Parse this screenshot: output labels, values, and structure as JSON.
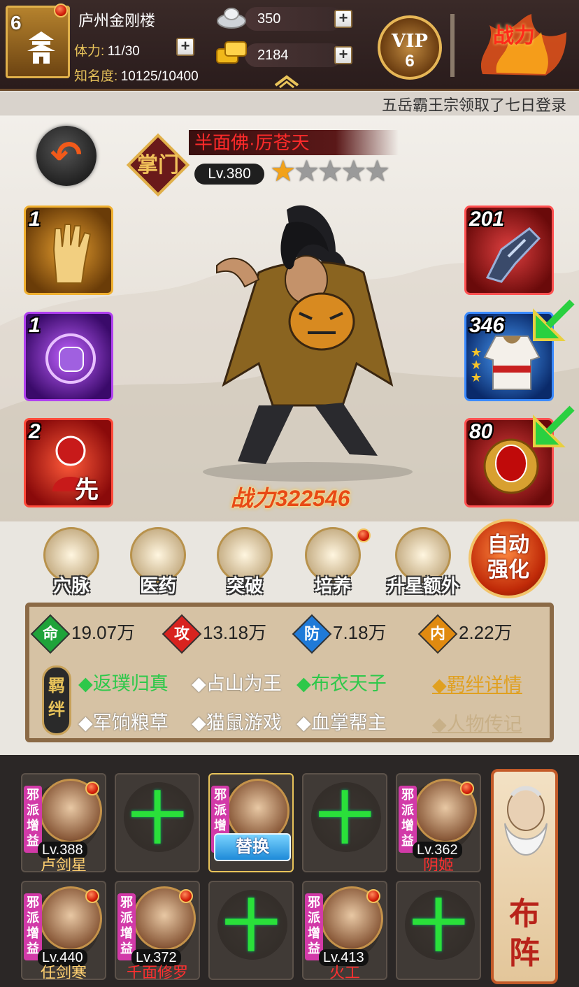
{
  "player": {
    "level": "6",
    "name": "庐州金刚楼"
  },
  "stats": {
    "stamina_label": "体力:",
    "stamina_value": "11/30",
    "fame_label": "知名度:",
    "fame_value": "10125/10400"
  },
  "resources": {
    "silver": "350",
    "gold": "2184"
  },
  "vip": {
    "label": "VIP",
    "level": "6"
  },
  "combat_top": {
    "label": "战力"
  },
  "marquee": "五岳霸王宗领取了七日登录",
  "hero": {
    "name": "半面佛·厉苍天",
    "level": "Lv.380",
    "stars_filled": 1,
    "stars_total": 5,
    "sect_badge": "掌门",
    "power_label": "战力",
    "power_value": "322546"
  },
  "skills": [
    {
      "level": "1",
      "icon": "palm-skill-icon"
    },
    {
      "level": "1",
      "icon": "fist-skill-icon"
    },
    {
      "level": "2",
      "icon": "first-strike-icon",
      "text": "先"
    }
  ],
  "equipment": [
    {
      "level": "201",
      "icon": "gauntlet-icon"
    },
    {
      "level": "346",
      "icon": "robe-icon",
      "upgrade": true
    },
    {
      "level": "80",
      "icon": "amulet-icon",
      "upgrade": true
    }
  ],
  "functions": [
    {
      "label": "穴脉",
      "icon": "meridian-icon"
    },
    {
      "label": "医药",
      "icon": "medicine-icon"
    },
    {
      "label": "突破",
      "icon": "breakthrough-icon"
    },
    {
      "label": "培养",
      "icon": "cultivate-icon",
      "badge": true
    },
    {
      "label": "升星额外",
      "icon": "star-upgrade-icon"
    }
  ],
  "auto_button": "自动强化",
  "attributes": [
    {
      "glyph": "命",
      "value": "19.07万",
      "color": "#1fa33a"
    },
    {
      "glyph": "攻",
      "value": "13.18万",
      "color": "#d8231f"
    },
    {
      "glyph": "防",
      "value": "7.18万",
      "color": "#1f7ad8"
    },
    {
      "glyph": "内",
      "value": "2.22万",
      "color": "#e08a10"
    }
  ],
  "bonds_badge": "羁绊",
  "bonds": [
    {
      "text": "◆返璞归真",
      "active": true
    },
    {
      "text": "◆占山为王",
      "active": false
    },
    {
      "text": "◆布衣天子",
      "active": true
    },
    {
      "text": "◆军饷粮草",
      "active": false
    },
    {
      "text": "◆猫鼠游戏",
      "active": false
    },
    {
      "text": "◆血掌帮主",
      "active": false
    }
  ],
  "links": {
    "bond_detail": "◆羁绊详情",
    "biography": "◆人物传记"
  },
  "lineup_tag": "邪派增益",
  "replace_button": "替换",
  "lineup": [
    {
      "type": "hero",
      "level": "Lv.388",
      "name": "卢剑星",
      "red": false
    },
    {
      "type": "empty",
      "symbol": "十"
    },
    {
      "type": "current"
    },
    {
      "type": "empty",
      "symbol": "十"
    },
    {
      "type": "hero",
      "level": "Lv.362",
      "name": "阴姬",
      "red": true
    },
    {
      "type": "hero",
      "level": "Lv.440",
      "name": "任剑寒",
      "red": false
    },
    {
      "type": "hero",
      "level": "Lv.372",
      "name": "千面修罗",
      "red": true
    },
    {
      "type": "empty",
      "symbol": "十"
    },
    {
      "type": "hero",
      "level": "Lv.413",
      "name": "火工",
      "red": true
    },
    {
      "type": "empty",
      "symbol": "十"
    }
  ],
  "formation_button": "布阵"
}
